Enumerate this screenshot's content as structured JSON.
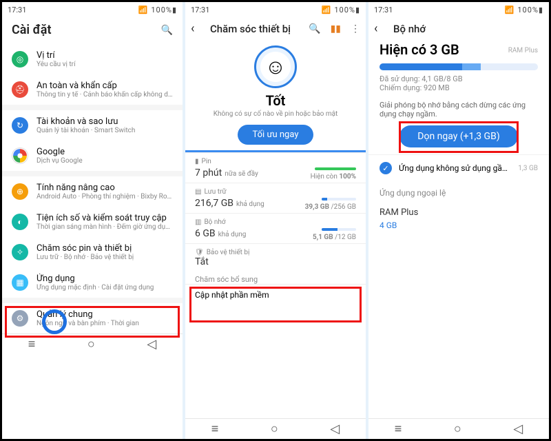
{
  "status": {
    "time": "17:31",
    "signal_text": "100%"
  },
  "panel1": {
    "title": "Cài đặt",
    "items": [
      {
        "label": "Vị trí",
        "sub": "Yêu cầu vị trí"
      },
      {
        "label": "An toàn và khẩn cấp",
        "sub": "Thông tin y tế · Cảnh báo khẩn cấp không dây"
      },
      {
        "label": "Tài khoản và sao lưu",
        "sub": "Quản lý tài khoản · Smart Switch"
      },
      {
        "label": "Google",
        "sub": "Dịch vụ Google"
      },
      {
        "label": "Tính năng nâng cao",
        "sub": "Android Auto · Phòng thí nghiệm · Bixby Routines"
      },
      {
        "label": "Tiện ích số và kiểm soát truy cập",
        "sub": "Thời gian sáng màn hình · Đếm giờ ứng dụng · Chế độ Ngủ"
      },
      {
        "label": "Chăm sóc pin và thiết bị",
        "sub": "Lưu trữ · Bộ nhớ · Bảo vệ thiết bị"
      },
      {
        "label": "Ứng dụng",
        "sub": "Ứng dụng mặc định · Cài đặt ứng dụng"
      },
      {
        "label": "Quản lý chung",
        "sub": "Ngôn ngữ và bàn phím · Thời gian"
      }
    ]
  },
  "panel2": {
    "title": "Chăm sóc thiết bị",
    "status_title": "Tốt",
    "status_sub": "Không có sự cố nào về pin hoặc bảo mật",
    "optimize_btn": "Tối ưu ngay",
    "pin": {
      "label": "Pin",
      "value": "7 phút",
      "suffix": "nữa sẽ đầy",
      "right": "100%",
      "right_prefix": "Hiện còn"
    },
    "storage": {
      "label": "Lưu trữ",
      "value": "216,7 GB",
      "suffix": "khả dụng",
      "used": "39,3 GB",
      "total": "/256 GB"
    },
    "memory": {
      "label": "Bộ nhớ",
      "value": "6 GB",
      "suffix": "khả dụng",
      "used": "5,1 GB",
      "total": "/12 GB"
    },
    "protect": {
      "label": "Bảo vệ thiết bị",
      "value": "Tắt"
    },
    "extra": "Chăm sóc bổ sung",
    "update": "Cập nhật phần mềm"
  },
  "panel3": {
    "title": "Bộ nhớ",
    "heading": "Hiện có 3 GB",
    "ramplus_label": "RAM Plus",
    "used_line": "Đã sử dụng: 4,1 GB/8 GB",
    "occupy_line": "Chiếm dụng: 920 MB",
    "desc": "Giải phóng bộ nhớ bằng cách dừng các ứng dụng chạy ngầm.",
    "clean_btn": "Dọn ngay (+1,3 GB)",
    "unused_label": "Ứng dụng không sử dụng gần đ…",
    "unused_size": "1,3 GB",
    "exclude_label": "Ứng dụng ngoại lệ",
    "ramplus_section": "RAM Plus",
    "ramplus_value": "4 GB"
  }
}
